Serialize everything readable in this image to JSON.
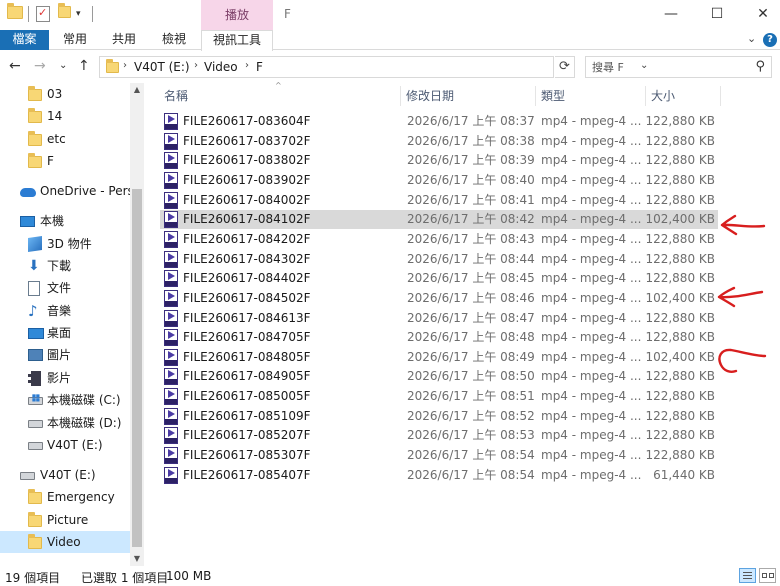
{
  "window": {
    "title": "F",
    "contextual_tab_header": "播放",
    "controls": {
      "minimize": "—",
      "maximize": "☐",
      "close": "✕"
    }
  },
  "ribbon": {
    "tabs": [
      "檔案",
      "常用",
      "共用",
      "檢視",
      "視訊工具"
    ],
    "collapse_glyph": "⌄",
    "help_glyph": "?"
  },
  "nav": {
    "back": "←",
    "forward": "→",
    "recent": "⌄",
    "up": "↑"
  },
  "address": {
    "crumbs": [
      "V40T (E:)",
      "Video",
      "F"
    ],
    "separator": "›",
    "dropdown": "⌄",
    "refresh": "⟳"
  },
  "search": {
    "placeholder": "搜尋 F",
    "icon": "search-icon"
  },
  "sidebar": {
    "items": [
      {
        "label": "03",
        "icon": "folder",
        "indent": 2
      },
      {
        "label": "14",
        "icon": "folder",
        "indent": 2
      },
      {
        "label": "etc",
        "icon": "folder",
        "indent": 2
      },
      {
        "label": "F",
        "icon": "folder",
        "indent": 2
      },
      {
        "label": "OneDrive - Perso",
        "icon": "cloud",
        "indent": 1
      },
      {
        "label": "本機",
        "icon": "pc",
        "indent": 1
      },
      {
        "label": "3D 物件",
        "icon": "objects-3d",
        "indent": 2
      },
      {
        "label": "下載",
        "icon": "download",
        "indent": 2
      },
      {
        "label": "文件",
        "icon": "document",
        "indent": 2
      },
      {
        "label": "音樂",
        "icon": "music",
        "indent": 2
      },
      {
        "label": "桌面",
        "icon": "desktop",
        "indent": 2
      },
      {
        "label": "圖片",
        "icon": "pictures",
        "indent": 2
      },
      {
        "label": "影片",
        "icon": "videos",
        "indent": 2
      },
      {
        "label": "本機磁碟 (C:)",
        "icon": "system-drive",
        "indent": 2
      },
      {
        "label": "本機磁碟 (D:)",
        "icon": "drive",
        "indent": 2
      },
      {
        "label": "V40T (E:)",
        "icon": "drive",
        "indent": 2
      },
      {
        "label": "V40T (E:)",
        "icon": "drive",
        "indent": 1
      },
      {
        "label": "Emergency",
        "icon": "folder",
        "indent": 2
      },
      {
        "label": "Picture",
        "icon": "folder",
        "indent": 2
      },
      {
        "label": "Video",
        "icon": "folder",
        "indent": 2,
        "selected": true
      }
    ]
  },
  "columns": {
    "name": "名稱",
    "date": "修改日期",
    "type": "類型",
    "size": "大小",
    "sort_glyph": "^"
  },
  "files": [
    {
      "name": "FILE260617-083604F",
      "date": "2026/6/17 上午 08:37",
      "type": "mp4 - mpeg-4 ...",
      "size": "122,880 KB"
    },
    {
      "name": "FILE260617-083702F",
      "date": "2026/6/17 上午 08:38",
      "type": "mp4 - mpeg-4 ...",
      "size": "122,880 KB"
    },
    {
      "name": "FILE260617-083802F",
      "date": "2026/6/17 上午 08:39",
      "type": "mp4 - mpeg-4 ...",
      "size": "122,880 KB"
    },
    {
      "name": "FILE260617-083902F",
      "date": "2026/6/17 上午 08:40",
      "type": "mp4 - mpeg-4 ...",
      "size": "122,880 KB"
    },
    {
      "name": "FILE260617-084002F",
      "date": "2026/6/17 上午 08:41",
      "type": "mp4 - mpeg-4 ...",
      "size": "122,880 KB"
    },
    {
      "name": "FILE260617-084102F",
      "date": "2026/6/17 上午 08:42",
      "type": "mp4 - mpeg-4 ...",
      "size": "102,400 KB",
      "selected": true
    },
    {
      "name": "FILE260617-084202F",
      "date": "2026/6/17 上午 08:43",
      "type": "mp4 - mpeg-4 ...",
      "size": "122,880 KB"
    },
    {
      "name": "FILE260617-084302F",
      "date": "2026/6/17 上午 08:44",
      "type": "mp4 - mpeg-4 ...",
      "size": "122,880 KB"
    },
    {
      "name": "FILE260617-084402F",
      "date": "2026/6/17 上午 08:45",
      "type": "mp4 - mpeg-4 ...",
      "size": "122,880 KB"
    },
    {
      "name": "FILE260617-084502F",
      "date": "2026/6/17 上午 08:46",
      "type": "mp4 - mpeg-4 ...",
      "size": "102,400 KB"
    },
    {
      "name": "FILE260617-084613F",
      "date": "2026/6/17 上午 08:47",
      "type": "mp4 - mpeg-4 ...",
      "size": "122,880 KB"
    },
    {
      "name": "FILE260617-084705F",
      "date": "2026/6/17 上午 08:48",
      "type": "mp4 - mpeg-4 ...",
      "size": "122,880 KB"
    },
    {
      "name": "FILE260617-084805F",
      "date": "2026/6/17 上午 08:49",
      "type": "mp4 - mpeg-4 ...",
      "size": "102,400 KB"
    },
    {
      "name": "FILE260617-084905F",
      "date": "2026/6/17 上午 08:50",
      "type": "mp4 - mpeg-4 ...",
      "size": "122,880 KB"
    },
    {
      "name": "FILE260617-085005F",
      "date": "2026/6/17 上午 08:51",
      "type": "mp4 - mpeg-4 ...",
      "size": "122,880 KB"
    },
    {
      "name": "FILE260617-085109F",
      "date": "2026/6/17 上午 08:52",
      "type": "mp4 - mpeg-4 ...",
      "size": "122,880 KB"
    },
    {
      "name": "FILE260617-085207F",
      "date": "2026/6/17 上午 08:53",
      "type": "mp4 - mpeg-4 ...",
      "size": "122,880 KB"
    },
    {
      "name": "FILE260617-085307F",
      "date": "2026/6/17 上午 08:54",
      "type": "mp4 - mpeg-4 ...",
      "size": "122,880 KB"
    },
    {
      "name": "FILE260617-085407F",
      "date": "2026/6/17 上午 08:54",
      "type": "mp4 - mpeg-4 ...",
      "size": "61,440 KB"
    }
  ],
  "status": {
    "item_count": "19 個項目",
    "selection": "已選取 1 個項目",
    "selection_size": "100 MB"
  },
  "colors": {
    "accent": "#1a6fb5",
    "contextual_tab": "#f7d6e9",
    "selected_row": "#d9d9d9",
    "selected_nav": "#cce8ff",
    "annotation": "#d81e1e"
  }
}
